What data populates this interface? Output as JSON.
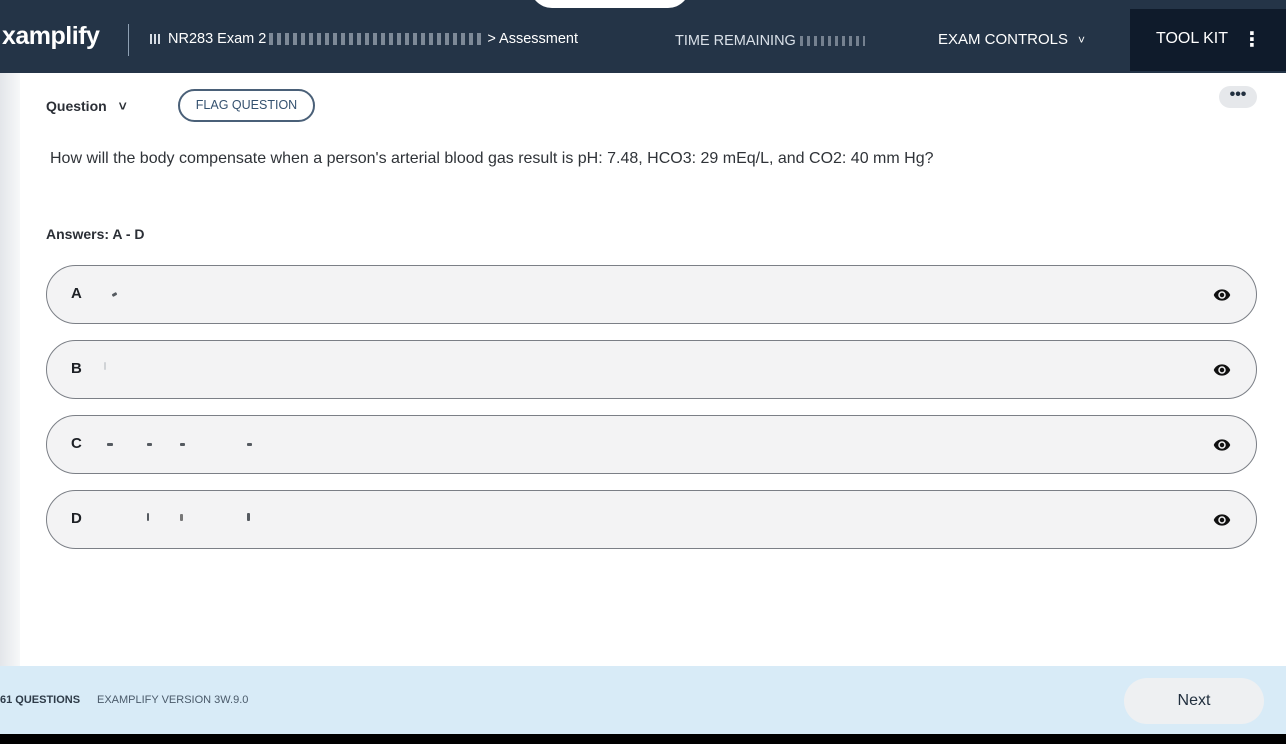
{
  "header": {
    "logo": "xamplify",
    "breadcrumb_course": "NR283 Exam 2",
    "breadcrumb_tail": "> Assessment",
    "time_label": "TIME REMAINING",
    "exam_controls_label": "EXAM CONTROLS",
    "toolkit_label": "TOOL KIT"
  },
  "question_bar": {
    "question_label": "Question",
    "flag_label": "FLAG QUESTION",
    "more_label": "•••"
  },
  "question": {
    "text": "How will the body compensate when a person's arterial blood gas result is pH: 7.48, HCO3: 29 mEq/L, and CO2: 40 mm Hg?",
    "answers_label": "Answers: A - D",
    "options": [
      {
        "letter": "A"
      },
      {
        "letter": "B"
      },
      {
        "letter": "C"
      },
      {
        "letter": "D"
      }
    ]
  },
  "footer": {
    "question_count": "61 QUESTIONS",
    "version": "EXAMPLIFY VERSION 3W.9.0",
    "next_label": "Next"
  },
  "colors": {
    "header_bg": "#243447",
    "toolkit_bg": "#0f1b2b",
    "footer_bg": "#d8ebf7",
    "option_bg": "#f3f3f4",
    "flag_border": "#4a6078"
  }
}
